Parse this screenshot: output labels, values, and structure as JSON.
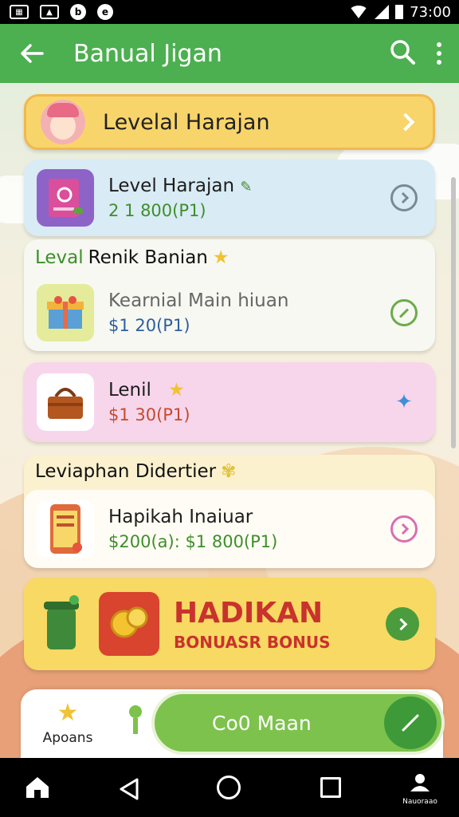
{
  "status_bar": {
    "time": "73:00"
  },
  "app_bar": {
    "title": "Banual Jigan"
  },
  "banner": {
    "title": "Levelal Harajan"
  },
  "items": [
    {
      "title": "Level Harajan",
      "price": "2 1 800(P1)",
      "price_color": "#3d8f2a"
    },
    {
      "section": "Renik Banian",
      "section_prefix": "Leval",
      "title": "Kearnial Main hiuan",
      "price": "$1 20(P1)",
      "price_color": "#2f5f9d"
    },
    {
      "title": "Lenil",
      "price": "$1 30(P1)",
      "price_color": "#c44b2d"
    },
    {
      "section": "Leviaphan Didertier",
      "title": "Hapikah Inaiuar",
      "price": "$200(a): $1 800(P1)",
      "price_color": "#3d8f2a"
    }
  ],
  "promo": {
    "title": "HADIKAN",
    "subtitle": "BONUASR BONUS"
  },
  "bottom": {
    "apps_label": "Apoans",
    "main_button": "Co0 Maan"
  },
  "nav": {
    "profile_label": "Nauoraao"
  },
  "colors": {
    "primary": "#4caf50",
    "accent": "#f8d56b",
    "promo_red": "#c8332d"
  }
}
